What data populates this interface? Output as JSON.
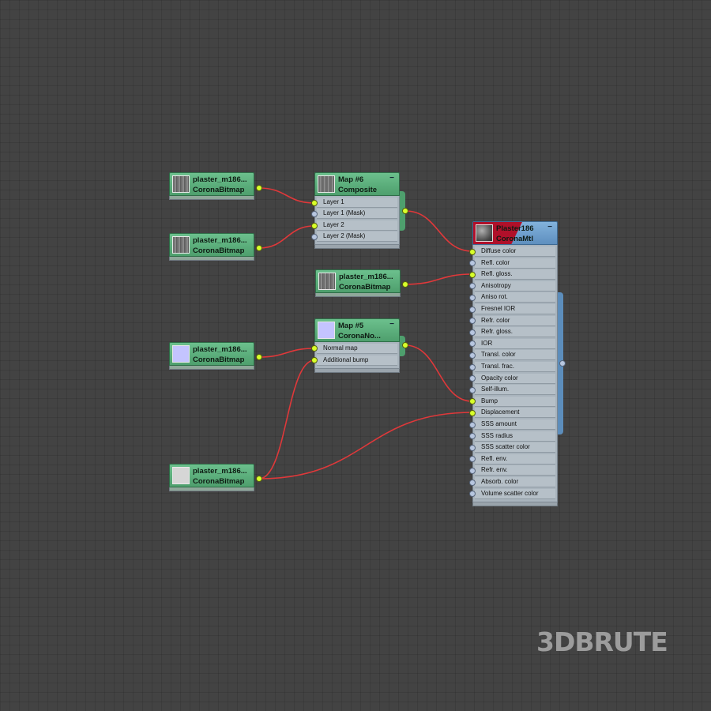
{
  "nodes": {
    "bitmap1": {
      "title": "plaster_m186...",
      "type": "CoronaBitmap",
      "thumb": "plaster-texture"
    },
    "bitmap2": {
      "title": "plaster_m186...",
      "type": "CoronaBitmap",
      "thumb": "plaster-texture"
    },
    "bitmap3": {
      "title": "plaster_m186...",
      "type": "CoronaBitmap",
      "thumb": "blue-normal-texture"
    },
    "bitmap4": {
      "title": "plaster_m186...",
      "type": "CoronaBitmap",
      "thumb": "light-gray-texture"
    },
    "bitmap5": {
      "title": "plaster_m186...",
      "type": "CoronaBitmap",
      "thumb": "plaster-texture"
    },
    "composite": {
      "title": "Map #6",
      "type": "Composite",
      "slots": [
        "Layer 1",
        "Layer 1 (Mask)",
        "Layer 2",
        "Layer 2 (Mask)"
      ]
    },
    "normal": {
      "title": "Map #5",
      "type": "CoronaNo...",
      "slots": [
        "Normal map",
        "Additional bump"
      ]
    },
    "material": {
      "title": "Plaster186",
      "type": "CoronaMtl",
      "slots": [
        "Diffuse color",
        "Refl. color",
        "Refl. gloss.",
        "Anisotropy",
        "Aniso rot.",
        "Fresnel IOR",
        "Refr. color",
        "Refr. gloss.",
        "IOR",
        "Transl. color",
        "Transl. frac.",
        "Opacity color",
        "Self-illum.",
        "Bump",
        "Displacement",
        "SSS amount",
        "SSS radius",
        "SSS scatter color",
        "Refl. env.",
        "Refr. env.",
        "Absorb. color",
        "Volume scatter color"
      ],
      "connected_slots": [
        "Diffuse color",
        "Refl. gloss.",
        "Bump",
        "Displacement"
      ]
    }
  },
  "collapse_symbol": "−",
  "watermark": "3DBRUTE",
  "colors": {
    "background": "#434343",
    "wire": "#e0383a",
    "socket_connected": "#d8ff2a",
    "socket_empty": "#b7c6df",
    "map_header": "#5fb07f",
    "material_header": "#6f9fcf",
    "material_selected": "#b0102a"
  }
}
